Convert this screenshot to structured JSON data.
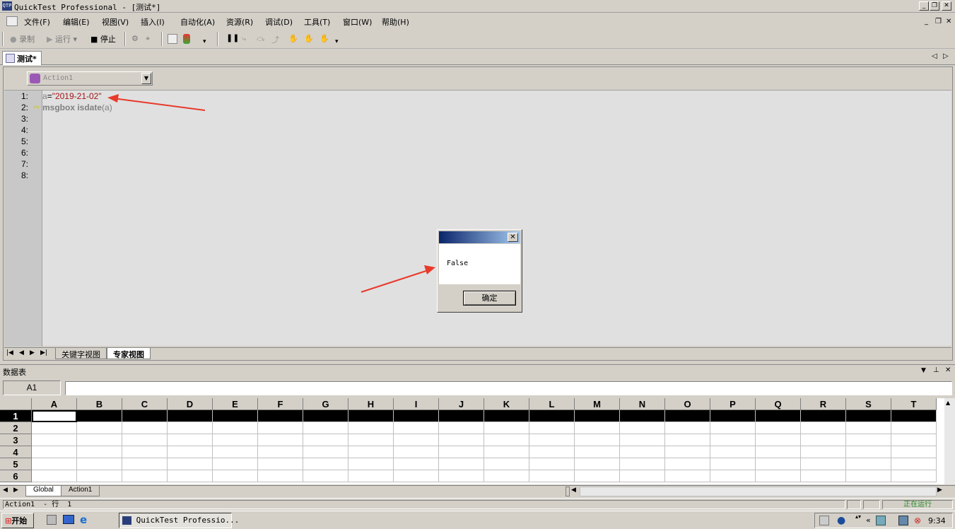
{
  "window": {
    "title": "QuickTest Professional - [测试*]",
    "app_icon": "QTP"
  },
  "menu": [
    "文件(F)",
    "编辑(E)",
    "视图(V)",
    "插入(I)",
    "自动化(A)",
    "资源(R)",
    "调试(D)",
    "工具(T)",
    "窗口(W)",
    "帮助(H)"
  ],
  "toolbar": {
    "record": "录制",
    "run": "运行",
    "stop": "停止"
  },
  "document_tab": "测试*",
  "editor": {
    "action_selected": "Action1",
    "line_numbers": [
      "1:",
      "2:",
      "3:",
      "4:",
      "5:",
      "6:",
      "7:",
      "8:"
    ],
    "line1_var": "a",
    "line1_eq": "=",
    "line1_str": "\"2019-21-02\"",
    "line2_kw": "msgbox isdate",
    "line2_arg": "(a)",
    "view_tab_keyword": "关键字视图",
    "view_tab_expert": "专家视图"
  },
  "msgbox": {
    "message": "False",
    "ok_label": "确定"
  },
  "datatable": {
    "title": "数据表",
    "cell_ref": "A1",
    "columns": [
      "A",
      "B",
      "C",
      "D",
      "E",
      "F",
      "G",
      "H",
      "I",
      "J",
      "K",
      "L",
      "M",
      "N",
      "O",
      "P",
      "Q",
      "R",
      "S",
      "T"
    ],
    "rows": [
      "1",
      "2",
      "3",
      "4",
      "5",
      "6"
    ],
    "sheet_tabs": [
      "Global",
      "Action1"
    ]
  },
  "status": {
    "left": "Action1  - 行  1",
    "right": "正在运行"
  },
  "taskbar": {
    "start": "开始",
    "task": "QuickTest Professio...",
    "clock": "9:34"
  },
  "colors": {
    "string": "#a31515",
    "keyword": "#808080",
    "arrow": "#e8392b",
    "selected_row": "#000000"
  }
}
